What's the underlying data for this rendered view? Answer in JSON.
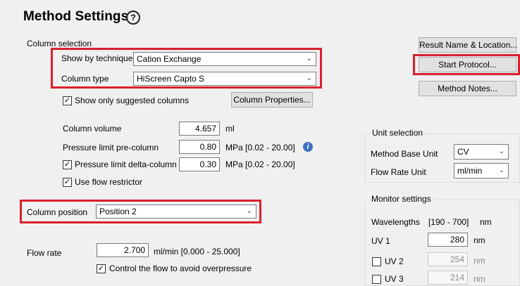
{
  "title": "Method Settings",
  "help_icon": "?",
  "column_selection": {
    "group_label": "Column selection",
    "technique_label": "Show by technique",
    "technique_value": "Cation Exchange",
    "column_type_label": "Column type",
    "column_type_value": "HiScreen Capto S",
    "show_suggested_label": "Show only suggested columns",
    "show_suggested_checked": true,
    "column_properties_button": "Column Properties...",
    "column_volume_label": "Column volume",
    "column_volume_value": "4.657",
    "column_volume_unit": "ml",
    "pressure_pre_label": "Pressure limit pre-column",
    "pressure_pre_value": "0.80",
    "pressure_pre_unit": "MPa [0.02 - 20.00]",
    "pressure_delta_label": "Pressure limit delta-column",
    "pressure_delta_checked": true,
    "pressure_delta_value": "0.30",
    "pressure_delta_unit": "MPa [0.02 - 20.00]",
    "flow_restrictor_label": "Use flow restrictor",
    "flow_restrictor_checked": true
  },
  "column_position": {
    "label": "Column position",
    "value": "Position 2"
  },
  "flow": {
    "label": "Flow rate",
    "value": "2.700",
    "unit": "ml/min  [0.000 - 25.000]",
    "control_label": "Control the flow to avoid overpressure",
    "control_checked": true
  },
  "buttons": {
    "result_name": "Result Name & Location...",
    "start_protocol": "Start Protocol...",
    "method_notes": "Method Notes..."
  },
  "unit_selection": {
    "group_label": "Unit selection",
    "base_unit_label": "Method Base Unit",
    "base_unit_value": "CV",
    "flow_unit_label": "Flow Rate Unit",
    "flow_unit_value": "ml/min"
  },
  "monitor": {
    "group_label": "Monitor settings",
    "wavelengths_label": "Wavelengths",
    "wavelengths_range": "[190 - 700]",
    "wavelengths_unit": "nm",
    "uv1_label": "UV 1",
    "uv1_value": "280",
    "uv1_unit": "nm",
    "uv2_label": "UV 2",
    "uv2_value": "254",
    "uv2_unit": "nm",
    "uv3_label": "UV 3",
    "uv3_value": "214",
    "uv3_unit": "nm"
  },
  "colors": {
    "highlight": "#d9202d",
    "info": "#3b73c4"
  },
  "icons": {
    "dropdown": "chevron-down-icon",
    "check": "check-icon",
    "info": "info-icon"
  }
}
